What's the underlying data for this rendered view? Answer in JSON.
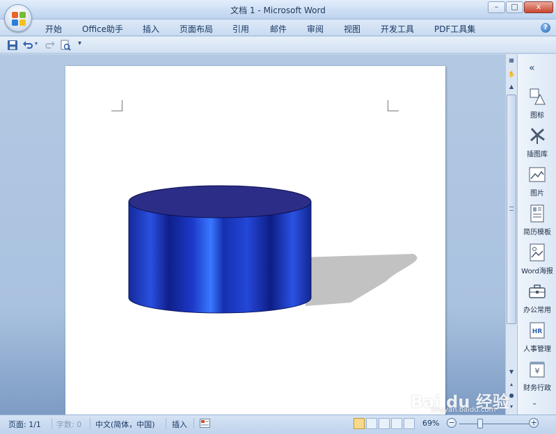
{
  "window": {
    "title": "文档 1 - Microsoft Word",
    "controls": {
      "minimize": "–",
      "maximize": "□",
      "close": "x"
    }
  },
  "menu": {
    "tabs": [
      "开始",
      "Office助手",
      "插入",
      "页面布局",
      "引用",
      "邮件",
      "审阅",
      "视图",
      "开发工具",
      "PDF工具集"
    ],
    "help": "?"
  },
  "qat": {
    "items": [
      "save-icon",
      "undo-icon",
      "redo-icon",
      "print-preview-icon",
      "customize-qat-icon"
    ],
    "customize": "▾"
  },
  "document": {
    "shape": "cylinder",
    "colors": {
      "body": "#1b2fb4",
      "highlight": "#2e6cff",
      "top": "#2b2d86",
      "shadow": "#c0c0c0"
    }
  },
  "sidepanel": {
    "collapse": "«",
    "items": [
      {
        "label": "图标",
        "icon": "shapes-icon"
      },
      {
        "label": "插图库",
        "icon": "windmill-icon"
      },
      {
        "label": "图片",
        "icon": "picture-icon"
      },
      {
        "label": "简历模板",
        "icon": "resume-icon"
      },
      {
        "label": "Word海报",
        "icon": "poster-icon"
      },
      {
        "label": "办公常用",
        "icon": "briefcase-icon"
      },
      {
        "label": "人事管理",
        "icon": "hr-icon"
      },
      {
        "label": "财务行政",
        "icon": "finance-icon"
      }
    ],
    "hr_text": "HR",
    "yen_text": "¥",
    "more": "⌄"
  },
  "statusbar": {
    "page": "页面: 1/1",
    "words": "字数: 0",
    "language": "中文(简体，中国)",
    "mode": "插入",
    "zoom": "69%",
    "zoom_value": 0.69
  },
  "watermark": {
    "text": "Bai du 经验",
    "sub": "jingyan.baidu.com"
  }
}
